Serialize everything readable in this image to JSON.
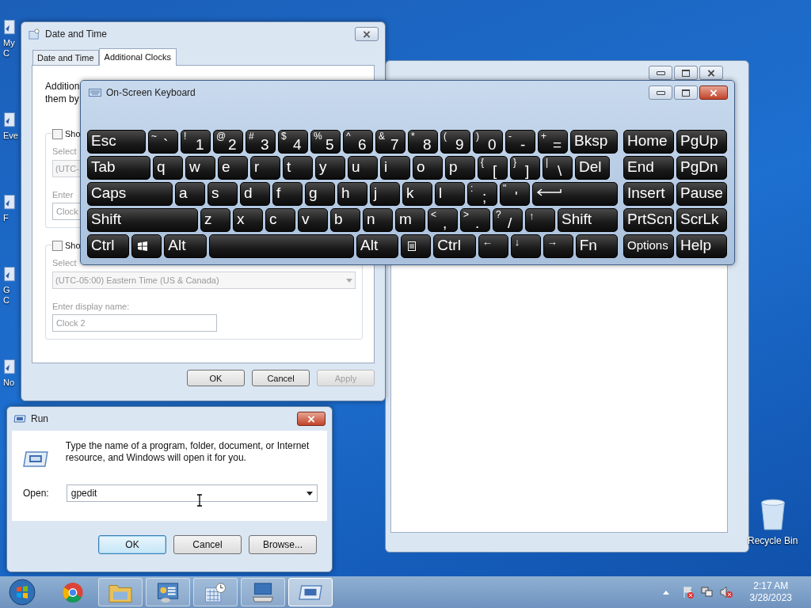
{
  "desktop": {
    "icons": [
      {
        "label": "My C"
      },
      {
        "label": "Eve"
      },
      {
        "label": "F"
      },
      {
        "label": "G\nC"
      },
      {
        "label": "No"
      }
    ],
    "recycle_bin": {
      "label": "Recycle Bin"
    }
  },
  "date_time": {
    "title": "Date and Time",
    "tabs": [
      {
        "label": "Date and Time",
        "selected": false
      },
      {
        "label": "Additional Clocks",
        "selected": true
      }
    ],
    "intro": [
      "Addition",
      "them by"
    ],
    "clocks": [
      {
        "checked": false,
        "show_label": "Sho",
        "select_label": "Select",
        "timezone": "(UTC-",
        "name_label": "Enter",
        "name": "Clock"
      },
      {
        "checked": false,
        "show_label": "Sho",
        "select_label": "Select",
        "timezone": "(UTC-05:00) Eastern Time (US & Canada)",
        "name_label": "Enter display name:",
        "name": "Clock 2"
      }
    ],
    "buttons": [
      {
        "label": "OK",
        "disabled": false
      },
      {
        "label": "Cancel",
        "disabled": false
      },
      {
        "label": "Apply",
        "disabled": true
      }
    ]
  },
  "keyboard": {
    "title": "On-Screen Keyboard",
    "rows": [
      {
        "keys": [
          {
            "kind": "text",
            "label": "Esc"
          },
          {
            "kind": "dual",
            "top": "~",
            "label": "`"
          },
          {
            "kind": "dual",
            "top": "!",
            "label": "1"
          },
          {
            "kind": "dual",
            "top": "@",
            "label": "2"
          },
          {
            "kind": "dual",
            "top": "#",
            "label": "3"
          },
          {
            "kind": "dual",
            "top": "$",
            "label": "4"
          },
          {
            "kind": "dual",
            "top": "%",
            "label": "5"
          },
          {
            "kind": "dual",
            "top": "^",
            "label": "6"
          },
          {
            "kind": "dual",
            "top": "&",
            "label": "7"
          },
          {
            "kind": "dual",
            "top": "*",
            "label": "8"
          },
          {
            "kind": "dual",
            "top": "(",
            "label": "9"
          },
          {
            "kind": "dual",
            "top": ")",
            "label": "0"
          },
          {
            "kind": "dual",
            "top": "-",
            "label": "-"
          },
          {
            "kind": "dual",
            "top": "+",
            "label": "="
          },
          {
            "kind": "text",
            "label": "Bksp"
          }
        ]
      },
      {
        "keys": [
          {
            "kind": "text",
            "label": "Tab"
          },
          {
            "kind": "char",
            "label": "q"
          },
          {
            "kind": "char",
            "label": "w"
          },
          {
            "kind": "char",
            "label": "e"
          },
          {
            "kind": "char",
            "label": "r"
          },
          {
            "kind": "char",
            "label": "t"
          },
          {
            "kind": "char",
            "label": "y"
          },
          {
            "kind": "char",
            "label": "u"
          },
          {
            "kind": "char",
            "label": "i"
          },
          {
            "kind": "char",
            "label": "o"
          },
          {
            "kind": "char",
            "label": "p"
          },
          {
            "kind": "dual",
            "top": "{",
            "label": "["
          },
          {
            "kind": "dual",
            "top": "}",
            "label": "]"
          },
          {
            "kind": "dual",
            "top": "|",
            "label": "\\"
          },
          {
            "kind": "text",
            "label": "Del"
          }
        ]
      },
      {
        "keys": [
          {
            "kind": "text",
            "label": "Caps"
          },
          {
            "kind": "char",
            "label": "a"
          },
          {
            "kind": "char",
            "label": "s"
          },
          {
            "kind": "char",
            "label": "d"
          },
          {
            "kind": "char",
            "label": "f"
          },
          {
            "kind": "char",
            "label": "g"
          },
          {
            "kind": "char",
            "label": "h"
          },
          {
            "kind": "char",
            "label": "j"
          },
          {
            "kind": "char",
            "label": "k"
          },
          {
            "kind": "char",
            "label": "l"
          },
          {
            "kind": "dual",
            "top": ":",
            "label": ";"
          },
          {
            "kind": "dual",
            "top": "\"",
            "label": "'"
          },
          {
            "kind": "enter"
          }
        ]
      },
      {
        "keys": [
          {
            "kind": "text",
            "label": "Shift"
          },
          {
            "kind": "char",
            "label": "z"
          },
          {
            "kind": "char",
            "label": "x"
          },
          {
            "kind": "char",
            "label": "c"
          },
          {
            "kind": "char",
            "label": "v"
          },
          {
            "kind": "char",
            "label": "b"
          },
          {
            "kind": "char",
            "label": "n"
          },
          {
            "kind": "char",
            "label": "m"
          },
          {
            "kind": "dual",
            "top": "<",
            "label": ","
          },
          {
            "kind": "dual",
            "top": ">",
            "label": "."
          },
          {
            "kind": "dual",
            "top": "?",
            "label": "/"
          },
          {
            "kind": "arrow",
            "label": "↑"
          },
          {
            "kind": "text",
            "label": "Shift"
          }
        ]
      },
      {
        "keys": [
          {
            "kind": "text",
            "label": "Ctrl"
          },
          {
            "kind": "windows"
          },
          {
            "kind": "text",
            "label": "Alt"
          },
          {
            "kind": "space"
          },
          {
            "kind": "text",
            "label": "Alt"
          },
          {
            "kind": "menu"
          },
          {
            "kind": "text",
            "label": "Ctrl"
          },
          {
            "kind": "arrow",
            "label": "←"
          },
          {
            "kind": "arrow",
            "label": "↓"
          },
          {
            "kind": "arrow",
            "label": "→"
          },
          {
            "kind": "text",
            "label": "Fn"
          }
        ]
      }
    ],
    "nav": [
      {
        "label": "Home"
      },
      {
        "label": "PgUp"
      },
      {
        "label": "End"
      },
      {
        "label": "PgDn"
      },
      {
        "label": "Insert"
      },
      {
        "label": "Pause"
      },
      {
        "label": "PrtScn"
      },
      {
        "label": "ScrLk"
      },
      {
        "label": "Options",
        "kind": "small"
      },
      {
        "label": "Help"
      }
    ]
  },
  "run": {
    "title": "Run",
    "message": "Type the name of a program, folder, document, or Internet resource, and Windows will open it for you.",
    "open_label": "Open:",
    "value": "gpedit",
    "buttons": [
      {
        "label": "OK",
        "selected": true
      },
      {
        "label": "Cancel",
        "selected": false
      },
      {
        "label": "Browse...",
        "selected": false
      }
    ]
  },
  "taskbar": {
    "items": [
      {
        "kind": "browser",
        "selected": false
      },
      {
        "kind": "folder",
        "selected": false
      },
      {
        "kind": "control-panel",
        "selected": false
      },
      {
        "kind": "calendar",
        "selected": false
      },
      {
        "kind": "keyboard",
        "selected": false
      },
      {
        "kind": "run",
        "selected": true
      }
    ],
    "time": "2:17 AM",
    "date": "3/28/2023"
  }
}
